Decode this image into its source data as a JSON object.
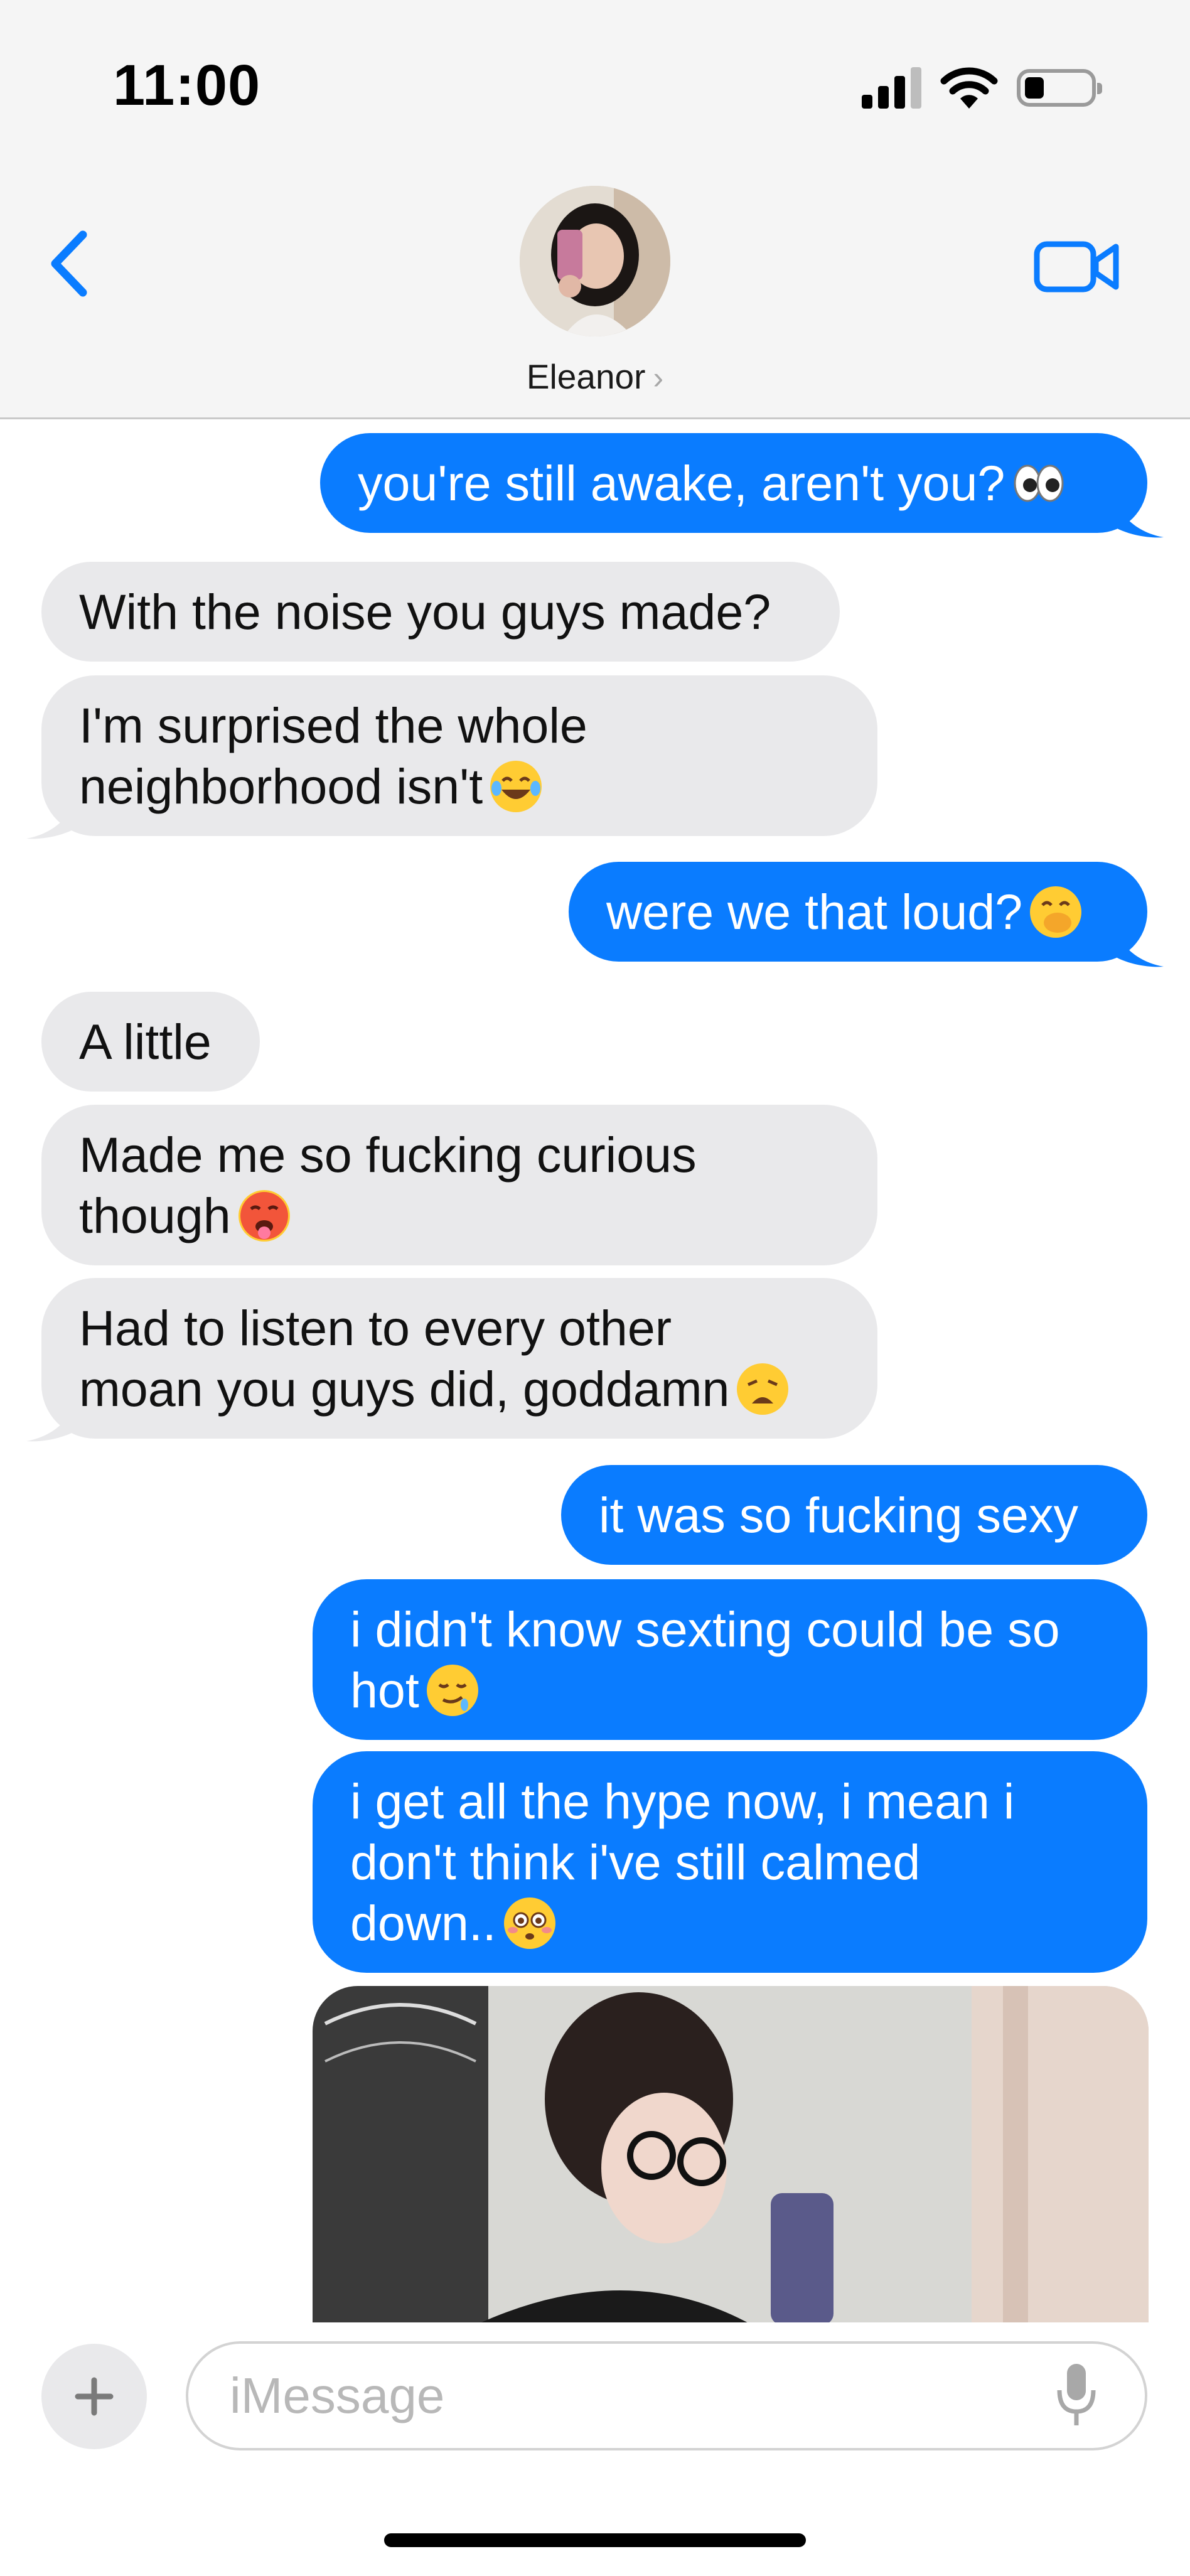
{
  "status_bar": {
    "time": "11:00"
  },
  "header": {
    "contact_name": "Eleanor",
    "name_chevron": "›"
  },
  "messages": [
    {
      "dir": "out",
      "lines": [
        "you're still awake, aren't you?"
      ],
      "emoji": "eyes"
    },
    {
      "dir": "in",
      "lines": [
        "With the noise you guys made?"
      ]
    },
    {
      "dir": "in",
      "lines": [
        "I'm surprised the whole",
        "neighborhood isn't"
      ],
      "emoji": "tears-of-joy"
    },
    {
      "dir": "out",
      "lines": [
        "were we that loud?"
      ],
      "emoji": "hand-over-mouth"
    },
    {
      "dir": "in",
      "lines": [
        "A little"
      ]
    },
    {
      "dir": "in",
      "lines": [
        "Made me so fucking curious",
        "though"
      ],
      "emoji": "hot-face"
    },
    {
      "dir": "in",
      "lines": [
        "Had to listen to every other",
        "moan you guys did, goddamn"
      ],
      "emoji": "weary-face"
    },
    {
      "dir": "out",
      "lines": [
        "it was so fucking sexy"
      ]
    },
    {
      "dir": "out",
      "lines": [
        "i didn't know sexting could be so",
        "hot"
      ],
      "emoji": "drooling-face"
    },
    {
      "dir": "out",
      "lines": [
        "i get all the hype now, i mean i",
        "don't think i've still calmed",
        "down.."
      ],
      "emoji": "flushed-face"
    }
  ],
  "composer": {
    "placeholder": "iMessage",
    "plus_label": "+"
  },
  "colors": {
    "outgoing": "#0a7cff",
    "incoming": "#e9e9eb",
    "accent": "#0a7cff"
  }
}
